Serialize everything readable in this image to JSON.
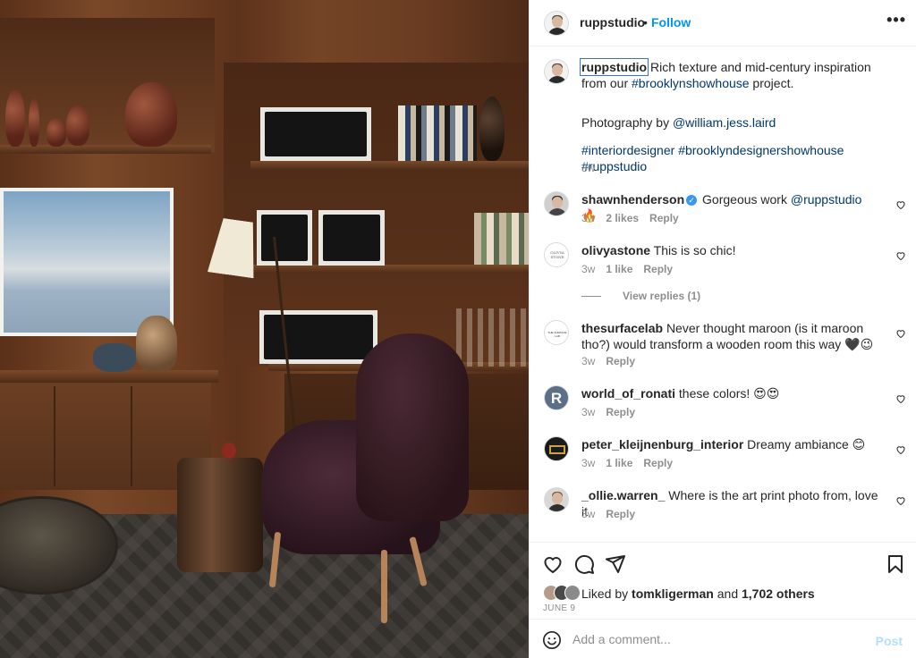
{
  "post": {
    "author": "ruppstudio",
    "separator": "•",
    "follow_label": "Follow",
    "more_label": "•••"
  },
  "caption": {
    "username": "ruppstudio",
    "text_1": " Rich texture and mid-century inspiration from our",
    "hashtag_1": "#brooklynshowhouse",
    "text_2": " project.",
    "photo_credit_prefix": "Photography by ",
    "photo_credit_handle": "@william.jess.laird",
    "hashtags": [
      "#interiordesigner",
      "#brooklyndesignershowhouse",
      "#ruppstudio"
    ],
    "time": "3w"
  },
  "comments": [
    {
      "username": "shawnhenderson",
      "verified": true,
      "text": "Gorgeous work ",
      "mention": "@ruppstudio",
      "emoji": " 🔥",
      "time": "3w",
      "likes": "2 likes",
      "reply": "Reply"
    },
    {
      "username": "olivyastone",
      "text": "This is so chic!",
      "time": "3w",
      "likes": "1 like",
      "reply": "Reply",
      "view_replies": "View replies (1)",
      "avatar_text": "OLIVYA STONE"
    },
    {
      "username": "thesurfacelab",
      "text": "Never thought maroon (is it maroon tho?) would transform a wooden room this way 🖤😉",
      "time": "3w",
      "reply": "Reply",
      "avatar_text": "THE SURFACE LAB"
    },
    {
      "username": "world_of_ronati",
      "text": "these colors! 😍😍",
      "time": "3w",
      "reply": "Reply",
      "avatar_text": "R"
    },
    {
      "username": "peter_kleijnenburg_interior",
      "text": "Dreamy ambiance 😊",
      "time": "3w",
      "likes": "1 like",
      "reply": "Reply"
    },
    {
      "username": "_ollie.warren_",
      "text": "Where is the art print photo from, love it",
      "time": "3w",
      "reply": "Reply"
    }
  ],
  "actions": {
    "liked_by_prefix": "Liked by ",
    "liked_by_user": "tomkligerman",
    "liked_by_middle": " and ",
    "liked_by_count": "1,702 others",
    "date": "JUNE 9"
  },
  "comment_box": {
    "placeholder": "Add a comment...",
    "post_label": "Post"
  },
  "icons": {
    "like": "heart-icon",
    "comment": "comment-icon",
    "share": "share-icon",
    "save": "bookmark-icon",
    "emoji": "emoji-icon",
    "more": "more-icon"
  },
  "colors": {
    "link": "#00376b",
    "follow": "#0095f6",
    "meta": "#8e8e8e",
    "post_disabled": "#b2dffc"
  }
}
